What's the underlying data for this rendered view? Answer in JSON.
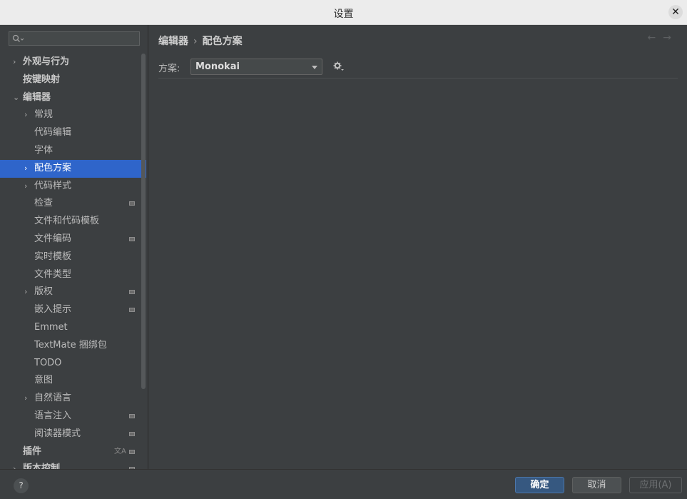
{
  "window": {
    "title": "设置",
    "close_glyph": "✕"
  },
  "search": {
    "placeholder": ""
  },
  "tree": [
    {
      "label": "外观与行为",
      "level": 0,
      "bold": true,
      "expandable": true,
      "expanded": false
    },
    {
      "label": "按键映射",
      "level": 0,
      "bold": true,
      "expandable": false
    },
    {
      "label": "编辑器",
      "level": 0,
      "bold": true,
      "expandable": true,
      "expanded": true
    },
    {
      "label": "常规",
      "level": 1,
      "expandable": true,
      "expanded": false
    },
    {
      "label": "代码编辑",
      "level": 1,
      "expandable": false
    },
    {
      "label": "字体",
      "level": 1,
      "expandable": false
    },
    {
      "label": "配色方案",
      "level": 1,
      "expandable": true,
      "expanded": false,
      "selected": true
    },
    {
      "label": "代码样式",
      "level": 1,
      "expandable": true,
      "expanded": false
    },
    {
      "label": "检查",
      "level": 1,
      "expandable": false,
      "badge": true
    },
    {
      "label": "文件和代码模板",
      "level": 1,
      "expandable": false
    },
    {
      "label": "文件编码",
      "level": 1,
      "expandable": false,
      "badge": true
    },
    {
      "label": "实时模板",
      "level": 1,
      "expandable": false
    },
    {
      "label": "文件类型",
      "level": 1,
      "expandable": false
    },
    {
      "label": "版权",
      "level": 1,
      "expandable": true,
      "expanded": false,
      "badge": true
    },
    {
      "label": "嵌入提示",
      "level": 1,
      "expandable": false,
      "badge": true
    },
    {
      "label": "Emmet",
      "level": 1,
      "expandable": false
    },
    {
      "label": "TextMate 捆绑包",
      "level": 1,
      "expandable": false
    },
    {
      "label": "TODO",
      "level": 1,
      "expandable": false
    },
    {
      "label": "意图",
      "level": 1,
      "expandable": false
    },
    {
      "label": "自然语言",
      "level": 1,
      "expandable": true,
      "expanded": false
    },
    {
      "label": "语言注入",
      "level": 1,
      "expandable": false,
      "badge": true
    },
    {
      "label": "阅读器模式",
      "level": 1,
      "expandable": false,
      "badge": true
    },
    {
      "label": "插件",
      "level": 0,
      "bold": true,
      "expandable": false,
      "badge": true,
      "translate_icon": true
    },
    {
      "label": "版本控制",
      "level": 0,
      "bold": true,
      "expandable": true,
      "expanded": false,
      "badge": true
    }
  ],
  "breadcrumb": {
    "parent": "编辑器",
    "separator": "›",
    "current": "配色方案"
  },
  "nav": {
    "back": "←",
    "forward": "→"
  },
  "scheme": {
    "label": "方案:",
    "value": "Monokai"
  },
  "footer": {
    "help": "?",
    "ok": "确定",
    "cancel": "取消",
    "apply": "应用(A)"
  },
  "colors": {
    "background": "#3c3f41",
    "selection": "#2f65ca",
    "ok_button": "#365880"
  }
}
